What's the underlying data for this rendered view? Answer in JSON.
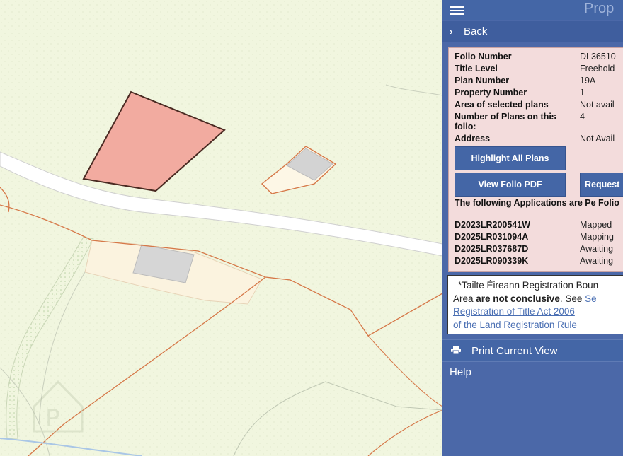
{
  "panel": {
    "title": "Prop",
    "back_label": "Back"
  },
  "folio": {
    "rows": [
      {
        "label": "Folio Number",
        "value": "DL36510"
      },
      {
        "label": "Title Level",
        "value": "Freehold"
      },
      {
        "label": "Plan Number",
        "value": "19A"
      },
      {
        "label": "Property Number",
        "value": "1"
      },
      {
        "label": "Area of selected plans",
        "value": "Not avail"
      },
      {
        "label": "Number of Plans on this folio:",
        "value": "4"
      },
      {
        "label": "Address",
        "value": "Not Avail"
      }
    ]
  },
  "buttons": {
    "highlight": "Highlight All Plans",
    "view_pdf": "View Folio PDF",
    "request": "Request"
  },
  "applications": {
    "heading": "The following Applications are Pe Folio",
    "items": [
      {
        "id": "D2023LR200541W",
        "status": "Mapped"
      },
      {
        "id": "D2025LR031094A",
        "status": "Mapping"
      },
      {
        "id": "D2025LR037687D",
        "status": "Awaiting"
      },
      {
        "id": "D2025LR090339K",
        "status": "Awaiting"
      }
    ]
  },
  "notice": {
    "line1": "*Tailte Éireann Registration Boun",
    "line2_prefix": "Area ",
    "line2_bold": "are not conclusive",
    "line2_suffix": ". See ",
    "line2_link": "Se",
    "link1": "Registration of Title Act 2006",
    "link2": "of the Land Registration Rule"
  },
  "menu": {
    "print": "Print Current View",
    "help": "Help"
  },
  "colors": {
    "panel": "#4b68a8",
    "parcel_fill": "#f2aba0",
    "boundary": "#d67848"
  }
}
